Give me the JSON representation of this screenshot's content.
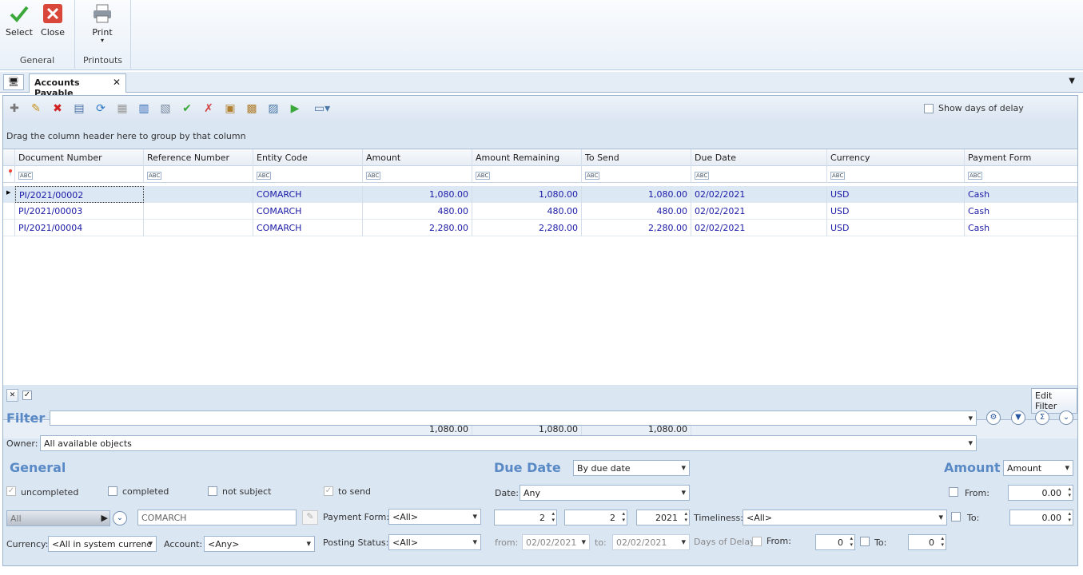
{
  "ribbon": {
    "groups": [
      {
        "label": "General"
      },
      {
        "label": "Printouts"
      }
    ],
    "buttons": {
      "select": "Select",
      "close": "Close",
      "print": "Print"
    }
  },
  "tab": {
    "title": "Accounts Payable"
  },
  "toolbar": {
    "show_delay_label": "Show days of delay"
  },
  "grid": {
    "group_hint": "Drag the column header here to group by that column",
    "columns": [
      "Document Number",
      "Reference Number",
      "Entity Code",
      "Amount",
      "Amount Remaining",
      "To Send",
      "Due Date",
      "Currency",
      "Payment Form"
    ],
    "rows": [
      {
        "doc": "PI/2021/00002",
        "ref": "",
        "entity": "COMARCH",
        "amount": "1,080.00",
        "remaining": "1,080.00",
        "tosend": "1,080.00",
        "due": "02/02/2021",
        "currency": "USD",
        "payment": "Cash"
      },
      {
        "doc": "PI/2021/00003",
        "ref": "",
        "entity": "COMARCH",
        "amount": "480.00",
        "remaining": "480.00",
        "tosend": "480.00",
        "due": "02/02/2021",
        "currency": "USD",
        "payment": "Cash"
      },
      {
        "doc": "PI/2021/00004",
        "ref": "",
        "entity": "COMARCH",
        "amount": "2,280.00",
        "remaining": "2,280.00",
        "tosend": "2,280.00",
        "due": "02/02/2021",
        "currency": "USD",
        "payment": "Cash"
      }
    ],
    "totals": {
      "amount": "1,080.00",
      "remaining": "1,080.00",
      "tosend": "1,080.00"
    }
  },
  "filter": {
    "edit_filter": "Edit Filter",
    "title": "Filter",
    "owner_label": "Owner:",
    "owner_value": "All available objects",
    "general": "General",
    "uncompleted": "uncompleted",
    "completed": "completed",
    "not_subject": "not subject",
    "to_send": "to send",
    "all_combo": "All",
    "entity_value": "COMARCH",
    "currency_label": "Currency:",
    "currency_value": "<All in system currenc",
    "account_label": "Account:",
    "account_value": "<Any>",
    "payment_form_label": "Payment Form:",
    "payment_form_value": "<All>",
    "posting_status_label": "Posting Status:",
    "posting_status_value": "<All>",
    "due_date": "Due Date",
    "due_mode": "By due date",
    "date_label": "Date:",
    "date_value": "Any",
    "spin1": "2",
    "spin2": "2",
    "spin3": "2021",
    "timeliness_label": "Timeliness:",
    "timeliness_value": "<All>",
    "from_label": "from:",
    "from_value": "02/02/2021",
    "to_label": "to:",
    "to_value": "02/02/2021",
    "days_delay_label": "Days of Delay:",
    "dd_from_label": "From:",
    "dd_from_value": "0",
    "dd_to_label": "To:",
    "dd_to_value": "0",
    "amount": "Amount",
    "amount_mode": "Amount",
    "amt_from_label": "From:",
    "amt_from_value": "0.00",
    "amt_to_label": "To:",
    "amt_to_value": "0.00"
  }
}
